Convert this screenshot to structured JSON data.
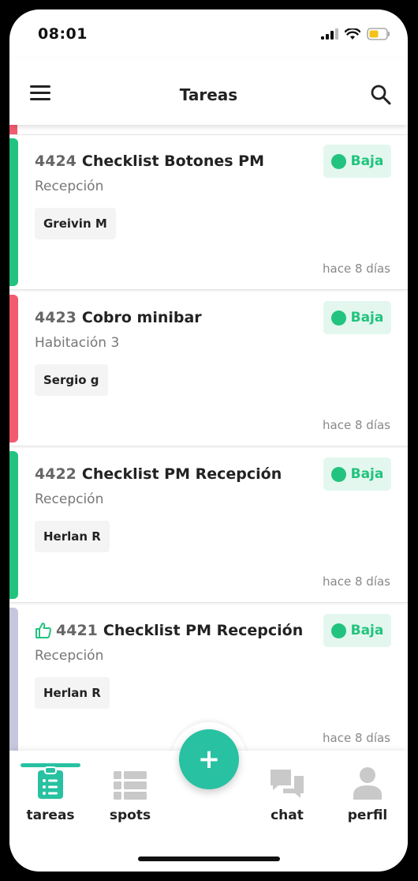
{
  "status_bar": {
    "time": "08:01"
  },
  "header": {
    "title": "Tareas"
  },
  "tasks": [
    {
      "number": "4424",
      "title": "Checklist Botones PM",
      "location": "Recepción",
      "assignee": "Greivin M",
      "priority": "Baja",
      "time_ago": "hace 8 días",
      "stripe_color": "#22c37e",
      "liked": false
    },
    {
      "number": "4423",
      "title": "Cobro minibar",
      "location": "Habitación 3",
      "assignee": "Sergio g",
      "priority": "Baja",
      "time_ago": "hace 8 días",
      "stripe_color": "#f25a6e",
      "liked": false
    },
    {
      "number": "4422",
      "title": "Checklist PM Recepción",
      "location": "Recepción",
      "assignee": "Herlan R",
      "priority": "Baja",
      "time_ago": "hace 8 días",
      "stripe_color": "#22c37e",
      "liked": false
    },
    {
      "number": "4421",
      "title": "Checklist PM Recepción",
      "location": "Recepción",
      "assignee": "Herlan R",
      "priority": "Baja",
      "time_ago": "hace 8 días",
      "stripe_color": "#c5c8dc",
      "liked": true
    }
  ],
  "bottom_nav": {
    "items": [
      {
        "label": "tareas",
        "icon": "clipboard-list-icon",
        "active": true
      },
      {
        "label": "spots",
        "icon": "grid-list-icon",
        "active": false
      },
      {
        "label": "chat",
        "icon": "chat-bubbles-icon",
        "active": false
      },
      {
        "label": "perfil",
        "icon": "person-icon",
        "active": false
      }
    ],
    "fab_label": "+"
  },
  "colors": {
    "accent": "#28c1a2",
    "priority_low": "#22c37e",
    "priority_low_bg": "#e3f7ee",
    "danger": "#f25a6e"
  }
}
